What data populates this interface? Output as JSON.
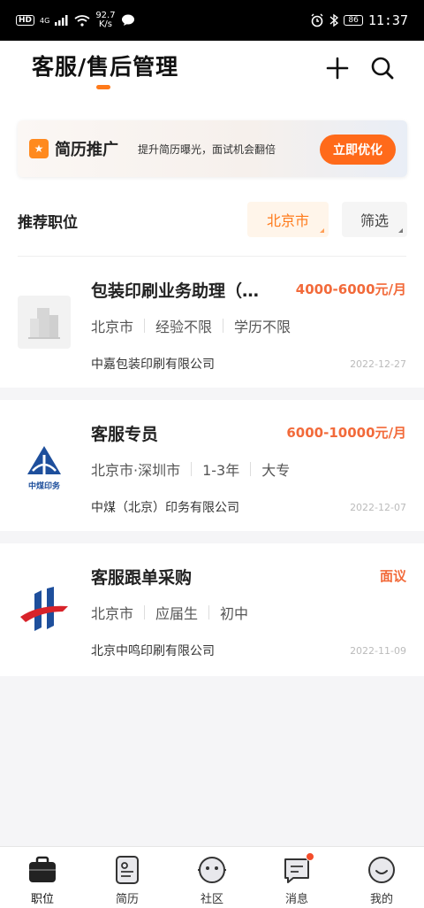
{
  "status_bar": {
    "hd": "HD",
    "network": "4G",
    "speed_value": "92.7",
    "speed_unit": "K/s",
    "battery": "86",
    "time": "11:37"
  },
  "header": {
    "title": "客服/售后管理",
    "add_icon": "plus-icon",
    "search_icon": "search-icon"
  },
  "banner": {
    "title": "简历推广",
    "description": "提升简历曝光，面试机会翻倍",
    "button_label": "立即优化"
  },
  "section": {
    "title": "推荐职位",
    "city_filter": "北京市",
    "filter_label": "筛选"
  },
  "jobs": [
    {
      "title": "包装印刷业务助理（…",
      "salary": "4000-6000元/月",
      "tags": [
        "北京市",
        "经验不限",
        "学历不限"
      ],
      "company": "中嘉包装印刷有限公司",
      "date": "2022-12-27",
      "logo": "building-placeholder-icon"
    },
    {
      "title": "客服专员",
      "salary": "6000-10000元/月",
      "tags": [
        "北京市·深圳市",
        "1-3年",
        "大专"
      ],
      "company": "中煤（北京）印务有限公司",
      "date": "2022-12-07",
      "logo": "zhongmei-logo",
      "logo_text": "中煤印务"
    },
    {
      "title": "客服跟单采购",
      "salary": "面议",
      "tags": [
        "北京市",
        "应届生",
        "初中"
      ],
      "company": "北京中鸣印刷有限公司",
      "date": "2022-11-09",
      "logo": "zhongming-logo"
    }
  ],
  "bottom_nav": [
    {
      "label": "职位",
      "icon": "briefcase-icon",
      "active": true
    },
    {
      "label": "简历",
      "icon": "resume-icon",
      "active": false
    },
    {
      "label": "社区",
      "icon": "community-icon",
      "active": false
    },
    {
      "label": "消息",
      "icon": "message-icon",
      "active": false,
      "badge": true
    },
    {
      "label": "我的",
      "icon": "profile-icon",
      "active": false
    }
  ],
  "colors": {
    "accent": "#ff7a1a",
    "salary": "#f26a3a",
    "button": "#ff6a1a"
  }
}
